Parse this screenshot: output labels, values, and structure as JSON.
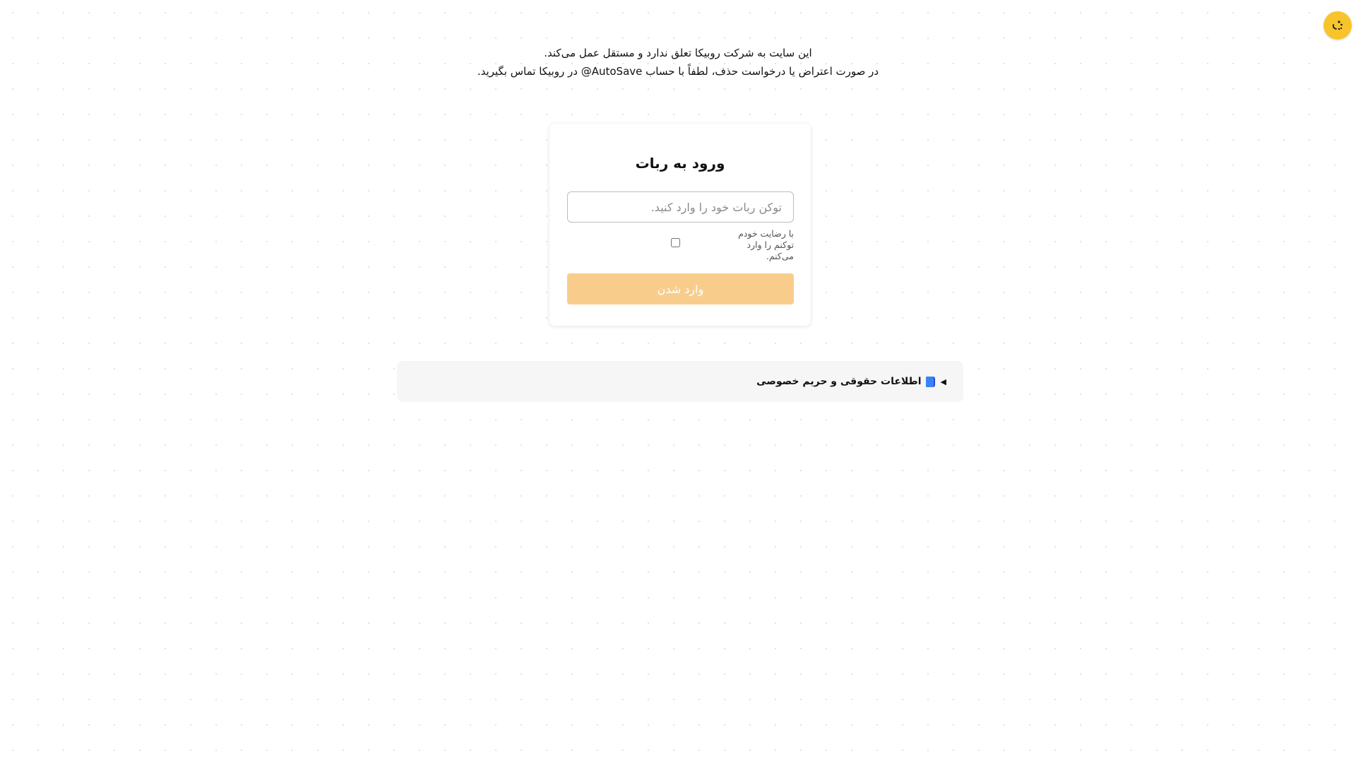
{
  "notice": {
    "line1": "این سایت به شرکت روبیکا تعلق ندارد و مستقل عمل می‌کند.",
    "line2": "در صورت اعتراض یا درخواست حذف، لطفاً با حساب AutoSave@ در روبیکا تماس بگیرید."
  },
  "login": {
    "title": "ورود به ربات",
    "token_placeholder": "توکن ربات خود را وارد کنید.",
    "token_value": "",
    "consent_label": "با رضایت خودم توکنم را وارد می‌کنم.",
    "consent_checked": false,
    "submit_label": "وارد شدن"
  },
  "legal": {
    "summary_label": "اطلاعات حقوقی و حریم خصوصی"
  },
  "icons": {
    "corner": "emoji-face-icon",
    "legal": "book-icon",
    "disclosure": "triangle-left-icon"
  },
  "colors": {
    "accent": "#f7c52b",
    "button_disabled": "#f8cd8c",
    "legal_background": "#f6f6f6"
  }
}
